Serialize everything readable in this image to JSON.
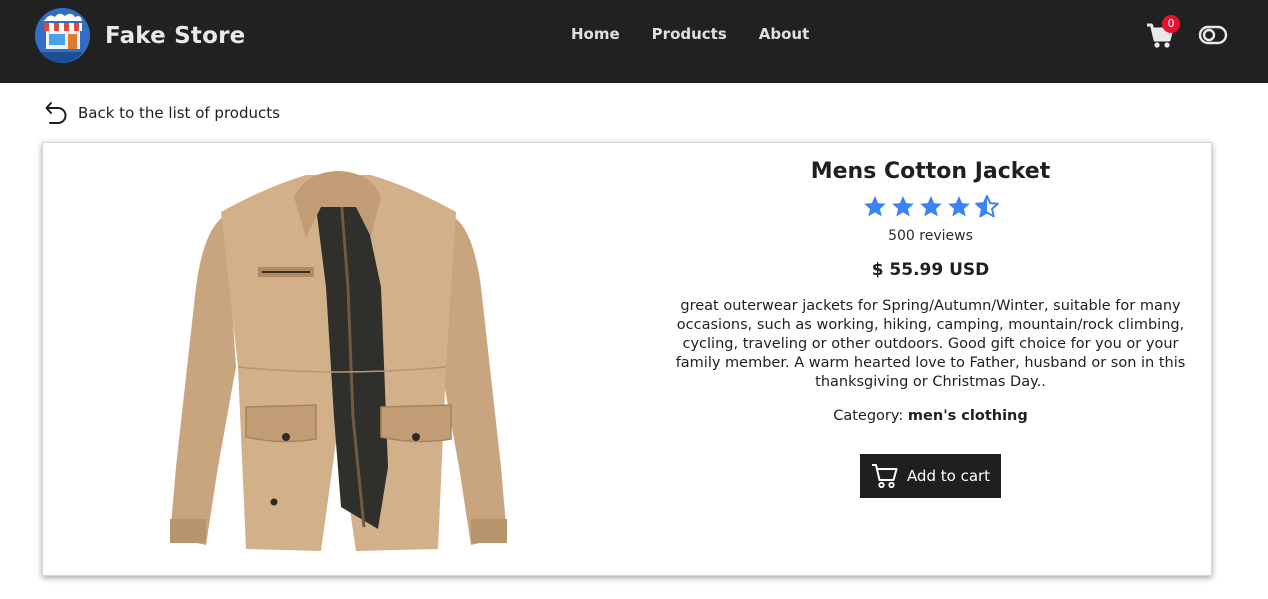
{
  "navbar": {
    "brand": "Fake Store",
    "links": [
      "Home",
      "Products",
      "About"
    ],
    "cart_count": "0",
    "colors": {
      "background": "#212121",
      "badge": "#e8112d"
    },
    "icons": [
      "store-logo-icon",
      "cart-icon",
      "theme-toggle-icon"
    ]
  },
  "back": {
    "label": "Back to the list of products",
    "icon": "undo-arrow-icon"
  },
  "product": {
    "title": "Mens Cotton Jacket",
    "rating": 4.7,
    "rating_max": 5,
    "reviews": "500 reviews",
    "price": "$ 55.99 USD",
    "description": "great outerwear jackets for Spring/Autumn/Winter, suitable for many occasions, such as working, hiking, camping, mountain/rock climbing, cycling, traveling or other outdoors. Good gift choice for you or your family member. A warm hearted love to Father, husband or son in this thanksgiving or Christmas Day..",
    "category_label": "Category:",
    "category_value": "men's clothing",
    "add_to_cart": "Add to cart",
    "star_color": "#3b82f6"
  }
}
